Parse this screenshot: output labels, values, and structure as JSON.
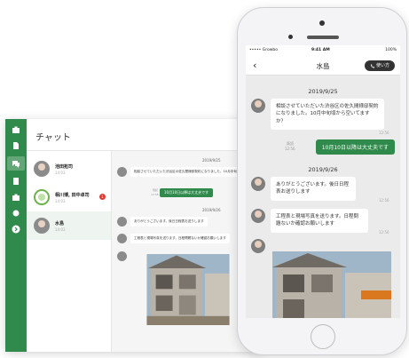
{
  "desktop": {
    "title": "チャット",
    "rail_icons": [
      "briefcase-icon",
      "document-icon",
      "chat-icon",
      "building-icon",
      "briefcase-icon",
      "gear-icon",
      "chevron-right-icon"
    ],
    "conversations": [
      {
        "name": "池田拓司",
        "sub": "14:03"
      },
      {
        "name": "相川博, 田中卓司",
        "sub": "14:03",
        "badge": "1"
      },
      {
        "name": "水島",
        "sub": "14:03"
      }
    ],
    "chat": {
      "date1": "2019/9/25",
      "msg1": "相談させていただいた渋谷区の佐久間様邸契約になりました。10月中旬頃から空いてますか？",
      "mine_read": "既読",
      "mine_time": "12:56",
      "mine": "10月10日以降は大丈夫です",
      "date2": "2019/9/26",
      "msg2": "ありがとうございます。後日日程表お送りします",
      "msg3": "工程表と現場写真を送ります。日程問題ないか確認お願いします"
    }
  },
  "phone": {
    "status": {
      "carrier": "••••• Growbo",
      "time": "9:41 AM",
      "battery": "100%"
    },
    "title": "水島",
    "help_label": "使い方",
    "date1": "2019/9/25",
    "msg1": "相談させていただいた渋谷区の佐久間様邸契約になりました。10月中旬頃から空いてますか？",
    "time1": "12:56",
    "mine_read": "既読",
    "mine_time": "12:56",
    "mine": "10月10日以降は大丈夫です",
    "date2": "2019/9/26",
    "msg2": "ありがとうございます。後日日程表お送りします",
    "time2": "12:56",
    "msg3": "工程表と現場写真を送ります。日程問題ないか確認お願いします",
    "time3": "12:56"
  },
  "colors": {
    "brand_green": "#2f8a4c",
    "badge_red": "#e53935"
  }
}
